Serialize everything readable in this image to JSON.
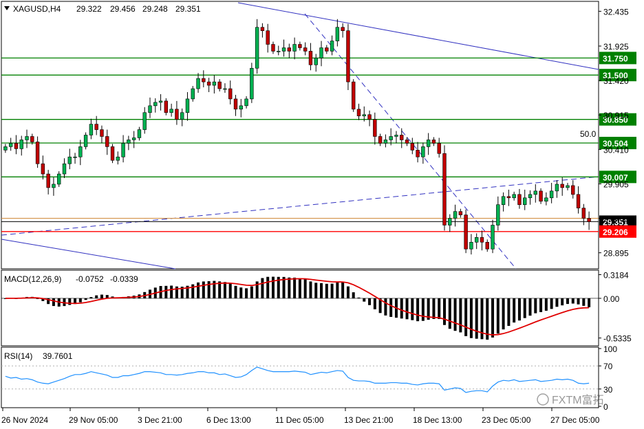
{
  "chart_data": [
    {
      "type": "candlestick",
      "panel": "price",
      "symbol": "XAGUSD,H4",
      "ohlc_header": [
        "29.322",
        "29.456",
        "29.248",
        "29.351"
      ],
      "y_ticks": [
        "32.435",
        "31.925",
        "31.420",
        "30.915",
        "30.410",
        "29.905",
        "29.400",
        "28.895"
      ],
      "ylim": [
        28.68,
        32.56
      ],
      "horizontal_levels": [
        {
          "value": 31.75,
          "label": "31.750",
          "color": "#008000"
        },
        {
          "value": 31.5,
          "label": "31.500",
          "color": "#008000"
        },
        {
          "value": 30.85,
          "label": "30.850",
          "color": "#008000"
        },
        {
          "value": 30.504,
          "label": "30.504",
          "color": "#008000"
        },
        {
          "value": 30.007,
          "label": "30.007",
          "color": "#008000"
        },
        {
          "value": 29.351,
          "label": "29.351",
          "color": "#000000"
        },
        {
          "value": 29.206,
          "label": "29.206",
          "color": "#ff0000"
        }
      ],
      "fib_label": "50.0",
      "close_series": [
        30.45,
        30.5,
        30.42,
        30.55,
        30.6,
        30.52,
        30.2,
        30.05,
        29.85,
        29.9,
        30.05,
        30.2,
        30.3,
        30.3,
        30.45,
        30.62,
        30.78,
        30.7,
        30.6,
        30.45,
        30.25,
        30.3,
        30.5,
        30.55,
        30.58,
        30.7,
        30.95,
        31.05,
        31.1,
        31.12,
        30.95,
        31.0,
        30.85,
        30.95,
        31.15,
        31.3,
        31.45,
        31.4,
        31.35,
        31.4,
        31.3,
        31.3,
        31.15,
        31.0,
        31.05,
        31.15,
        31.6,
        32.2,
        32.15,
        31.95,
        31.85,
        31.85,
        31.9,
        31.85,
        31.95,
        31.9,
        31.85,
        31.65,
        31.75,
        31.9,
        31.85,
        32.0,
        32.2,
        32.15,
        31.4,
        31.0,
        30.9,
        30.92,
        30.85,
        30.6,
        30.5,
        30.55,
        30.6,
        30.62,
        30.55,
        30.5,
        30.4,
        30.3,
        30.45,
        30.55,
        30.5,
        30.35,
        29.3,
        29.4,
        29.5,
        29.45,
        28.95,
        29.05,
        29.12,
        29.05,
        28.95,
        29.3,
        29.6,
        29.72,
        29.7,
        29.75,
        29.6,
        29.7,
        29.75,
        29.8,
        29.65,
        29.7,
        29.8,
        29.9,
        29.85,
        29.88,
        29.75,
        29.55,
        29.4,
        29.35
      ]
    },
    {
      "type": "bar+line",
      "panel": "macd",
      "label": "MACD(12,26,9)",
      "values_text": [
        "-0.0752",
        "-0.0339"
      ],
      "y_ticks": [
        "0.3184",
        "0.00",
        "-0.5335"
      ],
      "ylim": [
        -0.62,
        0.36
      ]
    },
    {
      "type": "line",
      "panel": "rsi",
      "label": "RSI(14)",
      "value_text": "39.7601",
      "y_ticks": [
        "100",
        "70",
        "30",
        "0"
      ],
      "ylim": [
        0,
        100
      ],
      "series": [
        52,
        49,
        50,
        47,
        48,
        46,
        42,
        40,
        39,
        42,
        45,
        48,
        52,
        55,
        55,
        57,
        60,
        58,
        56,
        54,
        50,
        50,
        53,
        53,
        55,
        57,
        60,
        60,
        59,
        58,
        55,
        55,
        54,
        55,
        57,
        58,
        60,
        60,
        58,
        58,
        55,
        56,
        53,
        50,
        51,
        55,
        62,
        68,
        65,
        62,
        60,
        60,
        60,
        60,
        61,
        60,
        59,
        55,
        57,
        59,
        58,
        60,
        62,
        61,
        50,
        45,
        44,
        44,
        43,
        40,
        40,
        40,
        41,
        41,
        40,
        40,
        38,
        37,
        39,
        40,
        40,
        39,
        28,
        30,
        32,
        31,
        24,
        26,
        27,
        27,
        25,
        35,
        42,
        45,
        44,
        46,
        43,
        44,
        45,
        46,
        43,
        44,
        45,
        47,
        46,
        47,
        45,
        40,
        39,
        40
      ]
    },
    {
      "type": "time-axis",
      "x_tick_labels": [
        "26 Nov 2024",
        "29 Nov 05:00",
        "3 Dec 21:00",
        "6 Dec 13:00",
        "11 Dec 05:00",
        "13 Dec 21:00",
        "18 Dec 13:00",
        "23 Dec 05:00",
        "27 Dec 05:00"
      ]
    }
  ],
  "watermark": "FXTM富拓",
  "colors": {
    "bull": "#00b050",
    "bear": "#c00000",
    "level": "#008000",
    "support": "#ff0000",
    "macd_hist": "#000000",
    "macd_signal": "#e00000",
    "rsi": "#1e90ff",
    "trendline": "#3030c0"
  }
}
